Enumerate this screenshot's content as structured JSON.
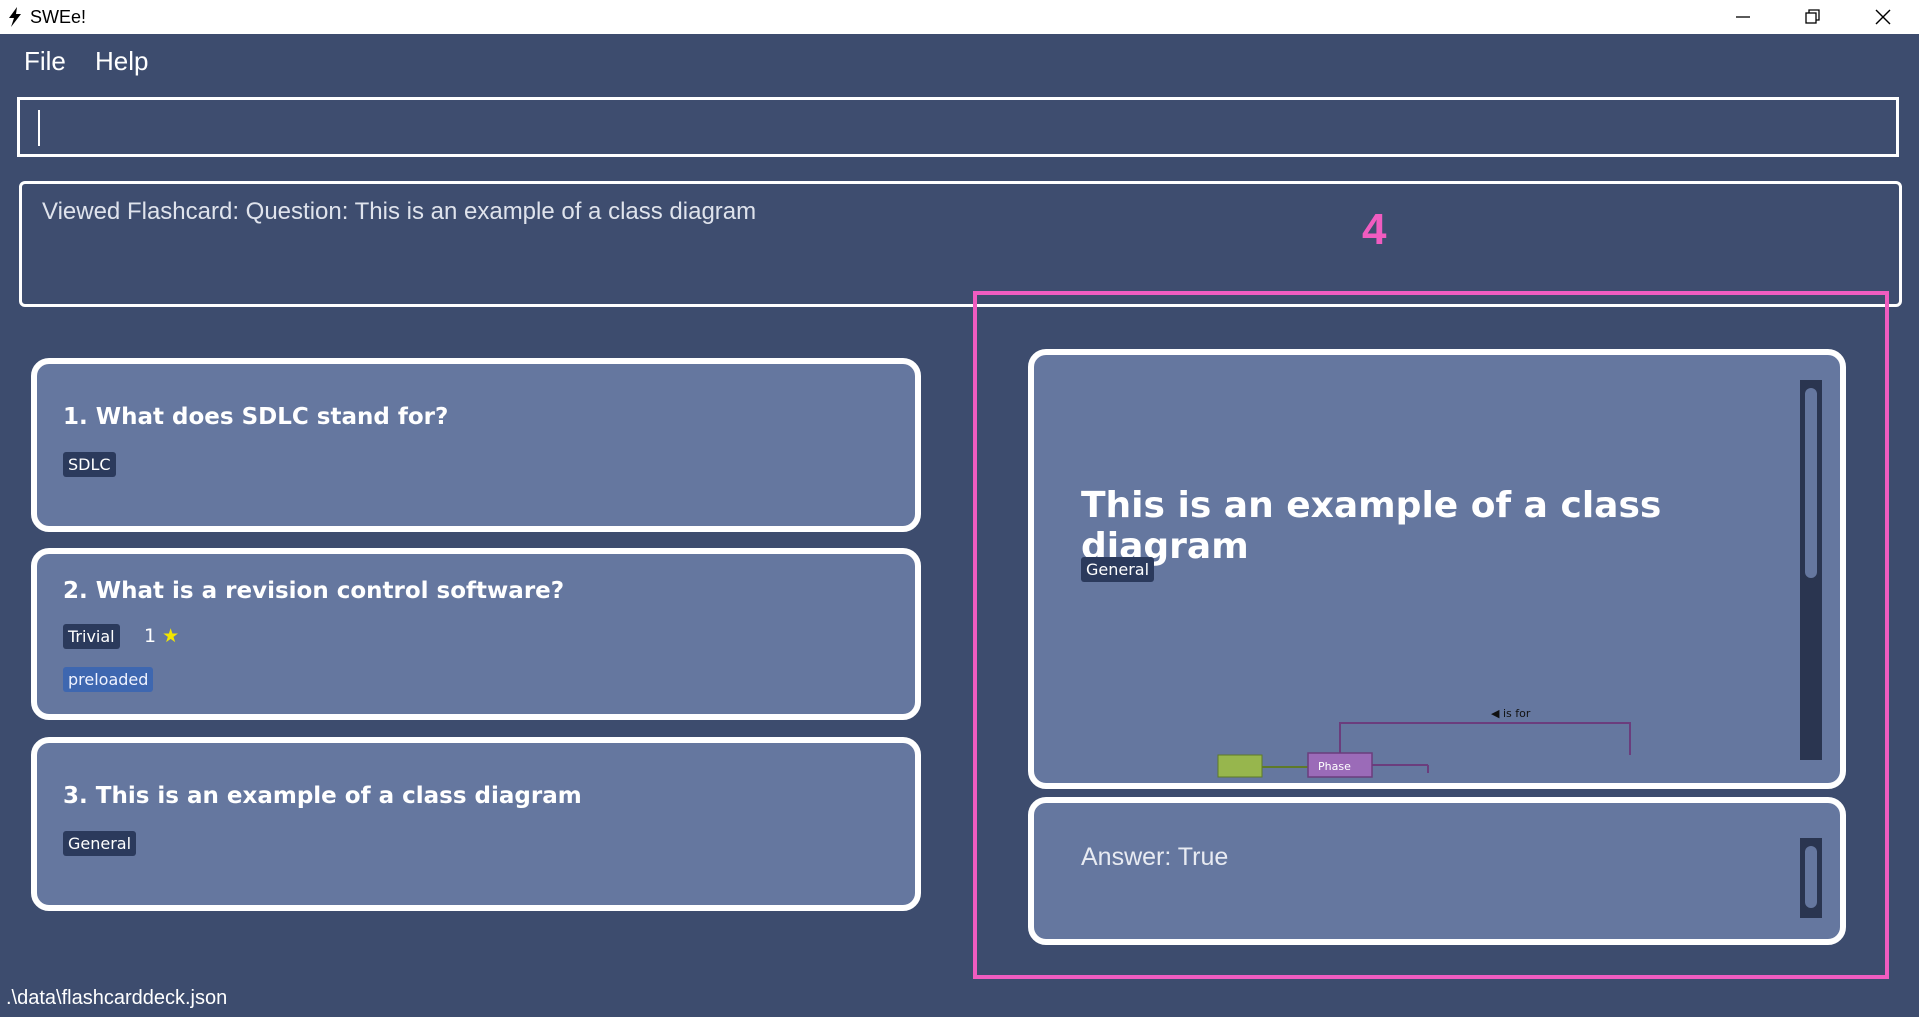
{
  "window": {
    "title": "SWEe!"
  },
  "menu": {
    "items": [
      "File",
      "Help"
    ]
  },
  "command": {
    "value": ""
  },
  "result": {
    "text": "Viewed Flashcard:  Question: This is an example of a class diagram"
  },
  "annotation": {
    "label": "4",
    "color": "#f05cc0"
  },
  "flashcards": [
    {
      "index": "1.",
      "question": "What does SDLC stand for?",
      "category": "SDLC"
    },
    {
      "index": "2.",
      "question": "What is a revision control software?",
      "category": "Trivial",
      "rating": "1",
      "tag": "preloaded"
    },
    {
      "index": "3.",
      "question": "This is an example of a class diagram",
      "category": "General"
    }
  ],
  "viewer": {
    "question": "This is an example of a class diagram",
    "category": "General",
    "diagram": {
      "assoc_label": "◀ is for",
      "class_label": "Phase"
    },
    "answer": "Answer: True"
  },
  "status": {
    "file_path": ".\\data\\flashcarddeck.json"
  }
}
